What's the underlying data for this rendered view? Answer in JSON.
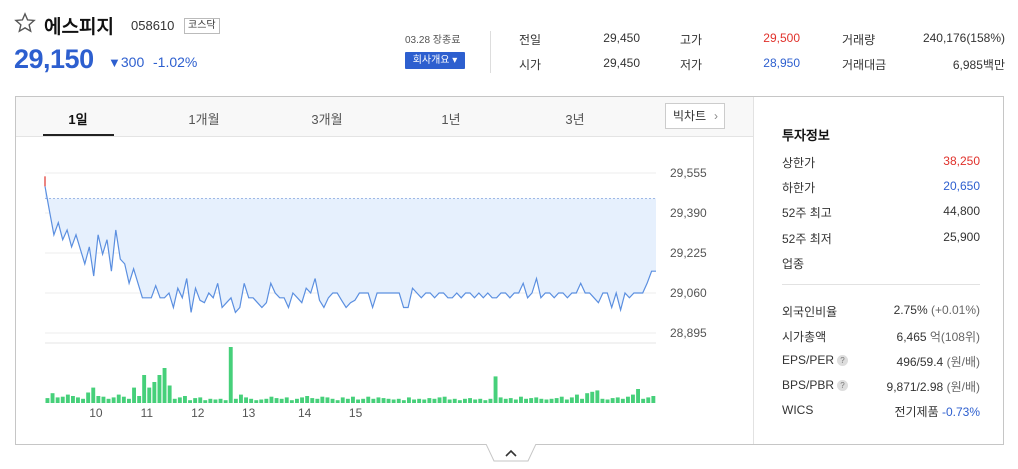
{
  "header": {
    "name": "에스피지",
    "code": "058610",
    "market": "코스닥",
    "price": "29,150",
    "change_arrow": "▼",
    "change": "300",
    "rate": "-1.02%",
    "date_info": "03.28 장종료",
    "company_button": "회사개요 ▾"
  },
  "quote": {
    "prev_close_label": "전일",
    "prev_close": "29,450",
    "high_label": "고가",
    "high": "29,500",
    "volume_label": "거래량",
    "volume": "240,176(158%)",
    "open_label": "시가",
    "open": "29,450",
    "low_label": "저가",
    "low": "28,950",
    "amount_label": "거래대금",
    "amount": "6,985백만"
  },
  "tabs": [
    "1일",
    "1개월",
    "3개월",
    "1년",
    "3년"
  ],
  "bigchart_label": "빅차트",
  "chart_data": {
    "type": "line",
    "ylim": [
      28895,
      29555
    ],
    "yticks": [
      "29,555",
      "29,390",
      "29,225",
      "29,060",
      "28,895"
    ],
    "ytick_values": [
      29555,
      29390,
      29225,
      29060,
      28895
    ],
    "reference": 29450,
    "xticks": [
      "10",
      "11",
      "12",
      "13",
      "14",
      "15"
    ],
    "xtick_index": [
      10,
      20,
      30,
      40,
      51,
      61
    ],
    "prices": [
      29500,
      29400,
      29300,
      29350,
      29280,
      29320,
      29250,
      29300,
      29240,
      29180,
      29250,
      29130,
      29300,
      29220,
      29280,
      29150,
      29320,
      29200,
      29180,
      29100,
      29160,
      29100,
      29040,
      29040,
      29040,
      29090,
      29040,
      29040,
      29060,
      29000,
      29080,
      29040,
      29120,
      28980,
      29080,
      29030,
      29020,
      29060,
      29040,
      29100,
      29000,
      29020,
      29040,
      28980,
      29000,
      29100,
      29040,
      29040,
      29020,
      29000,
      29020,
      29100,
      29060,
      29040,
      29040,
      29000,
      29060,
      29040,
      29020,
      29080,
      29060,
      29120,
      29030,
      29000,
      29040,
      29060,
      29060,
      29030,
      29000,
      29020,
      29030,
      29060,
      29060,
      29060,
      29000,
      29060,
      29060,
      29060,
      29060,
      29060,
      29060,
      29000,
      29000,
      29080,
      29060,
      29040,
      29060,
      29060,
      29040,
      29060,
      29060,
      29040,
      29040,
      29060,
      29040,
      29060,
      29060,
      29040,
      29060,
      29040,
      29060,
      29040,
      29040,
      29060,
      29060,
      29040,
      29060,
      29060,
      29100,
      29040,
      29060,
      29120,
      29040,
      29060,
      29060,
      29040,
      29060,
      29060,
      29040,
      29060,
      29060,
      29100,
      29060,
      29060,
      29040,
      29020,
      29060,
      29060,
      29000,
      29060,
      28990,
      29060,
      29040,
      29060,
      29060,
      29060,
      29100,
      29150,
      29150
    ],
    "volumes": [
      7,
      14,
      8,
      9,
      12,
      10,
      8,
      6,
      15,
      22,
      10,
      9,
      6,
      8,
      12,
      9,
      6,
      22,
      10,
      40,
      22,
      30,
      40,
      50,
      25,
      6,
      8,
      10,
      4,
      7,
      8,
      4,
      6,
      5,
      6,
      4,
      80,
      6,
      12,
      8,
      6,
      4,
      5,
      6,
      9,
      7,
      6,
      8,
      4,
      6,
      8,
      10,
      7,
      6,
      9,
      8,
      6,
      4,
      8,
      6,
      9,
      5,
      6,
      9,
      6,
      8,
      7,
      6,
      5,
      6,
      4,
      8,
      5,
      6,
      5,
      7,
      6,
      8,
      9,
      5,
      6,
      4,
      6,
      7,
      5,
      6,
      4,
      6,
      38,
      8,
      6,
      7,
      5,
      9,
      6,
      7,
      8,
      6,
      5,
      6,
      7,
      9,
      5,
      8,
      12,
      6,
      14,
      16,
      18,
      6,
      5,
      7,
      8,
      6,
      9,
      12,
      20,
      6,
      8,
      10
    ]
  },
  "side": {
    "title": "투자정보",
    "rows": [
      {
        "label": "상한가",
        "value": "38,250",
        "color": "#e0312b"
      },
      {
        "label": "하한가",
        "value": "20,650",
        "color": "#2d5fcf"
      },
      {
        "label": "52주 최고",
        "value": "44,800"
      },
      {
        "label": "52주 최저",
        "value": "25,900"
      },
      {
        "label": "업종",
        "value": ""
      }
    ],
    "rows2": [
      {
        "label": "외국인비율",
        "value": "2.75%",
        "extra": "(+0.01%)"
      },
      {
        "label": "시가총액",
        "value": "6,465",
        "extra": "억(108위)"
      },
      {
        "label": "EPS/PER",
        "value": "496/59.4",
        "extra": "(원/배)"
      },
      {
        "label": "BPS/PBR",
        "value": "9,871/2.98",
        "extra": "(원/배)"
      },
      {
        "label": "WICS",
        "value": "전기제품",
        "extra": "-0.73%"
      }
    ]
  },
  "colors": {
    "accent": "#2d5fcf",
    "up": "#e0312b",
    "volume": "#46d07a",
    "area": "#e6f0fd"
  }
}
